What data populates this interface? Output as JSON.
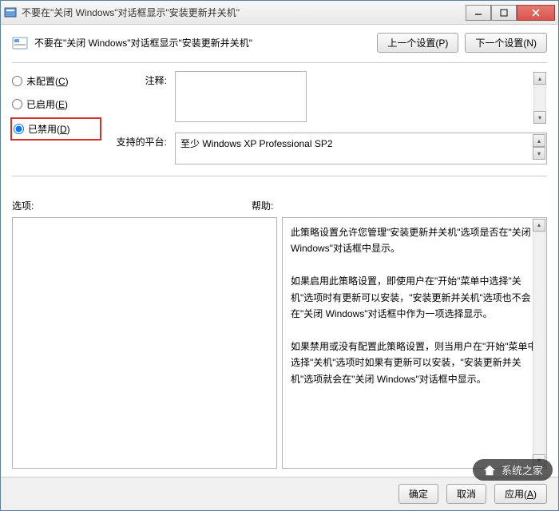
{
  "titlebar": {
    "text": "不要在\"关闭 Windows\"对话框显示\"安装更新并关机\""
  },
  "header": {
    "title": "不要在\"关闭 Windows\"对话框显示\"安装更新并关机\"",
    "prev": "上一个设置(P)",
    "next": "下一个设置(N)"
  },
  "radios": {
    "not_configured": "未配置(C)",
    "enabled": "已启用(E)",
    "disabled": "已禁用(D)",
    "selected": "disabled"
  },
  "fields": {
    "comment_label": "注释:",
    "comment_value": "",
    "platform_label": "支持的平台:",
    "platform_value": "至少 Windows XP Professional SP2"
  },
  "sections": {
    "options_label": "选项:",
    "help_label": "帮助:"
  },
  "help": {
    "p1": "此策略设置允许您管理\"安装更新并关机\"选项是否在\"关闭 Windows\"对话框中显示。",
    "p2": "如果启用此策略设置，即使用户在\"开始\"菜单中选择\"关机\"选项时有更新可以安装，\"安装更新并关机\"选项也不会在\"关闭 Windows\"对话框中作为一项选择显示。",
    "p3": "如果禁用或没有配置此策略设置，则当用户在\"开始\"菜单中选择\"关机\"选项时如果有更新可以安装，\"安装更新并关机\"选项就会在\"关闭 Windows\"对话框中显示。"
  },
  "footer": {
    "ok": "确定",
    "cancel": "取消",
    "apply": "应用(A)"
  },
  "watermark": {
    "text": "系统之家"
  }
}
